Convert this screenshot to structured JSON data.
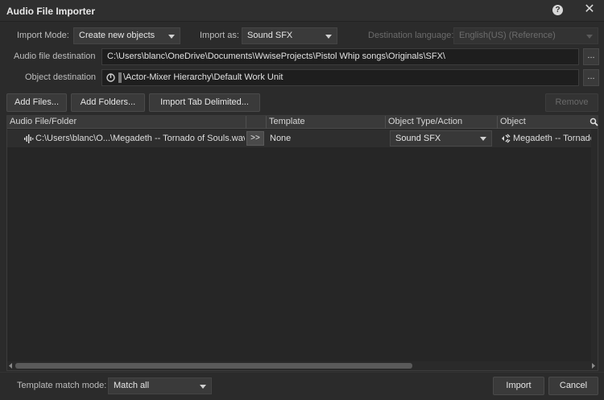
{
  "window": {
    "title": "Audio File Importer",
    "help_glyph": "?",
    "close_glyph": "✕"
  },
  "import_mode": {
    "label": "Import Mode:",
    "value": "Create new objects"
  },
  "import_as": {
    "label": "Import as:",
    "value": "Sound SFX"
  },
  "destination_language": {
    "label": "Destination language:",
    "value": "English(US) (Reference)"
  },
  "audio_file_destination": {
    "label": "Audio file destination",
    "value": "C:\\Users\\blanc\\OneDrive\\Documents\\WwiseProjects\\Pistol Whip songs\\Originals\\SFX\\",
    "browse": "..."
  },
  "object_destination": {
    "label": "Object destination",
    "value": "\\Actor-Mixer Hierarchy\\Default Work Unit",
    "browse": "..."
  },
  "toolbar": {
    "add_files": "Add Files...",
    "add_folders": "Add Folders...",
    "import_tab_delimited": "Import Tab Delimited...",
    "remove": "Remove"
  },
  "table": {
    "columns": [
      "Audio File/Folder",
      "Template",
      "Object Type/Action",
      "Object"
    ],
    "rows": [
      {
        "file": "C:\\Users\\blanc\\O...\\Megadeth -- Tornado of Souls.wav",
        "transfer": ">>",
        "template": "None",
        "object_type": "Sound SFX",
        "object": "Megadeth -- Tornado of Souls"
      }
    ]
  },
  "footer": {
    "template_match_label": "Template match mode:",
    "template_match_value": "Match all",
    "import": "Import",
    "cancel": "Cancel"
  },
  "colors": {
    "background": "#2b2b2b",
    "field_background": "#1e1e1e",
    "header_background": "#3a3a3a"
  }
}
